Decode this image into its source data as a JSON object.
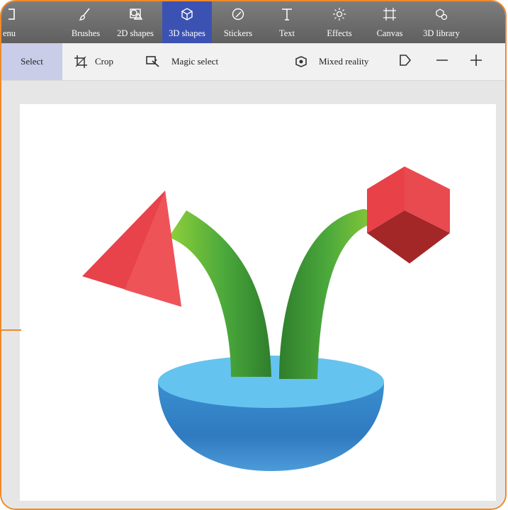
{
  "toolbar": {
    "items": [
      {
        "label": "enu",
        "icon": "menu-icon"
      },
      {
        "label": "Brushes",
        "icon": "brush-icon"
      },
      {
        "label": "2D shapes",
        "icon": "2d-shapes-icon"
      },
      {
        "label": "3D shapes",
        "icon": "cube-icon",
        "active": true
      },
      {
        "label": "Stickers",
        "icon": "sticker-icon"
      },
      {
        "label": "Text",
        "icon": "text-icon"
      },
      {
        "label": "Effects",
        "icon": "effects-icon"
      },
      {
        "label": "Canvas",
        "icon": "canvas-icon"
      },
      {
        "label": "3D library",
        "icon": "3d-library-icon"
      }
    ]
  },
  "subbar": {
    "select": "Select",
    "crop": "Crop",
    "magic_select": "Magic select",
    "mixed_reality": "Mixed reality"
  },
  "colors": {
    "frame_border": "#ee8a2b",
    "active_tab": "#3c52b3",
    "pyramid": "#e8424a",
    "tube": "#4aa83b",
    "bowl": "#3a8fd0",
    "cube": "#e84148"
  }
}
